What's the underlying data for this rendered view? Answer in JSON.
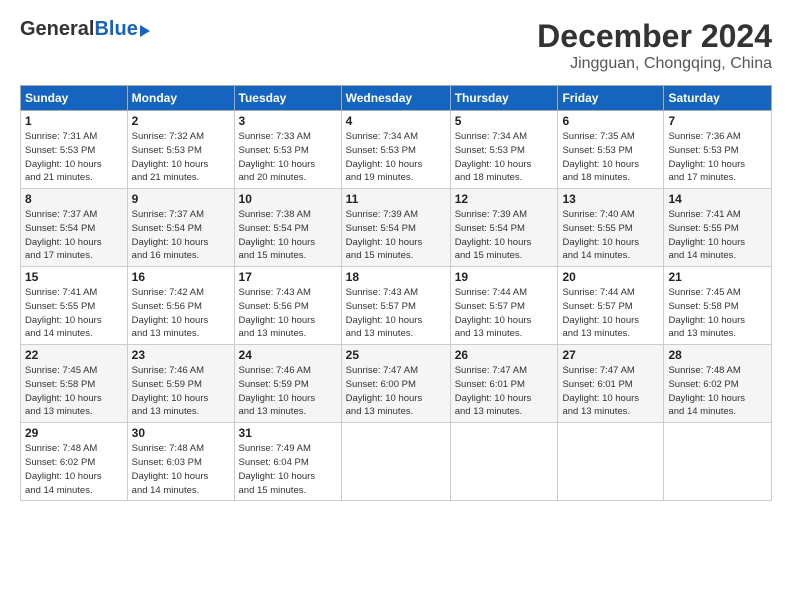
{
  "header": {
    "logo_general": "General",
    "logo_blue": "Blue",
    "month_title": "December 2024",
    "location": "Jingguan, Chongqing, China"
  },
  "days_of_week": [
    "Sunday",
    "Monday",
    "Tuesday",
    "Wednesday",
    "Thursday",
    "Friday",
    "Saturday"
  ],
  "weeks": [
    [
      {
        "day": "1",
        "info": "Sunrise: 7:31 AM\nSunset: 5:53 PM\nDaylight: 10 hours\nand 21 minutes."
      },
      {
        "day": "2",
        "info": "Sunrise: 7:32 AM\nSunset: 5:53 PM\nDaylight: 10 hours\nand 21 minutes."
      },
      {
        "day": "3",
        "info": "Sunrise: 7:33 AM\nSunset: 5:53 PM\nDaylight: 10 hours\nand 20 minutes."
      },
      {
        "day": "4",
        "info": "Sunrise: 7:34 AM\nSunset: 5:53 PM\nDaylight: 10 hours\nand 19 minutes."
      },
      {
        "day": "5",
        "info": "Sunrise: 7:34 AM\nSunset: 5:53 PM\nDaylight: 10 hours\nand 18 minutes."
      },
      {
        "day": "6",
        "info": "Sunrise: 7:35 AM\nSunset: 5:53 PM\nDaylight: 10 hours\nand 18 minutes."
      },
      {
        "day": "7",
        "info": "Sunrise: 7:36 AM\nSunset: 5:53 PM\nDaylight: 10 hours\nand 17 minutes."
      }
    ],
    [
      {
        "day": "8",
        "info": "Sunrise: 7:37 AM\nSunset: 5:54 PM\nDaylight: 10 hours\nand 17 minutes."
      },
      {
        "day": "9",
        "info": "Sunrise: 7:37 AM\nSunset: 5:54 PM\nDaylight: 10 hours\nand 16 minutes."
      },
      {
        "day": "10",
        "info": "Sunrise: 7:38 AM\nSunset: 5:54 PM\nDaylight: 10 hours\nand 15 minutes."
      },
      {
        "day": "11",
        "info": "Sunrise: 7:39 AM\nSunset: 5:54 PM\nDaylight: 10 hours\nand 15 minutes."
      },
      {
        "day": "12",
        "info": "Sunrise: 7:39 AM\nSunset: 5:54 PM\nDaylight: 10 hours\nand 15 minutes."
      },
      {
        "day": "13",
        "info": "Sunrise: 7:40 AM\nSunset: 5:55 PM\nDaylight: 10 hours\nand 14 minutes."
      },
      {
        "day": "14",
        "info": "Sunrise: 7:41 AM\nSunset: 5:55 PM\nDaylight: 10 hours\nand 14 minutes."
      }
    ],
    [
      {
        "day": "15",
        "info": "Sunrise: 7:41 AM\nSunset: 5:55 PM\nDaylight: 10 hours\nand 14 minutes."
      },
      {
        "day": "16",
        "info": "Sunrise: 7:42 AM\nSunset: 5:56 PM\nDaylight: 10 hours\nand 13 minutes."
      },
      {
        "day": "17",
        "info": "Sunrise: 7:43 AM\nSunset: 5:56 PM\nDaylight: 10 hours\nand 13 minutes."
      },
      {
        "day": "18",
        "info": "Sunrise: 7:43 AM\nSunset: 5:57 PM\nDaylight: 10 hours\nand 13 minutes."
      },
      {
        "day": "19",
        "info": "Sunrise: 7:44 AM\nSunset: 5:57 PM\nDaylight: 10 hours\nand 13 minutes."
      },
      {
        "day": "20",
        "info": "Sunrise: 7:44 AM\nSunset: 5:57 PM\nDaylight: 10 hours\nand 13 minutes."
      },
      {
        "day": "21",
        "info": "Sunrise: 7:45 AM\nSunset: 5:58 PM\nDaylight: 10 hours\nand 13 minutes."
      }
    ],
    [
      {
        "day": "22",
        "info": "Sunrise: 7:45 AM\nSunset: 5:58 PM\nDaylight: 10 hours\nand 13 minutes."
      },
      {
        "day": "23",
        "info": "Sunrise: 7:46 AM\nSunset: 5:59 PM\nDaylight: 10 hours\nand 13 minutes."
      },
      {
        "day": "24",
        "info": "Sunrise: 7:46 AM\nSunset: 5:59 PM\nDaylight: 10 hours\nand 13 minutes."
      },
      {
        "day": "25",
        "info": "Sunrise: 7:47 AM\nSunset: 6:00 PM\nDaylight: 10 hours\nand 13 minutes."
      },
      {
        "day": "26",
        "info": "Sunrise: 7:47 AM\nSunset: 6:01 PM\nDaylight: 10 hours\nand 13 minutes."
      },
      {
        "day": "27",
        "info": "Sunrise: 7:47 AM\nSunset: 6:01 PM\nDaylight: 10 hours\nand 13 minutes."
      },
      {
        "day": "28",
        "info": "Sunrise: 7:48 AM\nSunset: 6:02 PM\nDaylight: 10 hours\nand 14 minutes."
      }
    ],
    [
      {
        "day": "29",
        "info": "Sunrise: 7:48 AM\nSunset: 6:02 PM\nDaylight: 10 hours\nand 14 minutes."
      },
      {
        "day": "30",
        "info": "Sunrise: 7:48 AM\nSunset: 6:03 PM\nDaylight: 10 hours\nand 14 minutes."
      },
      {
        "day": "31",
        "info": "Sunrise: 7:49 AM\nSunset: 6:04 PM\nDaylight: 10 hours\nand 15 minutes."
      },
      {
        "day": "",
        "info": ""
      },
      {
        "day": "",
        "info": ""
      },
      {
        "day": "",
        "info": ""
      },
      {
        "day": "",
        "info": ""
      }
    ]
  ]
}
